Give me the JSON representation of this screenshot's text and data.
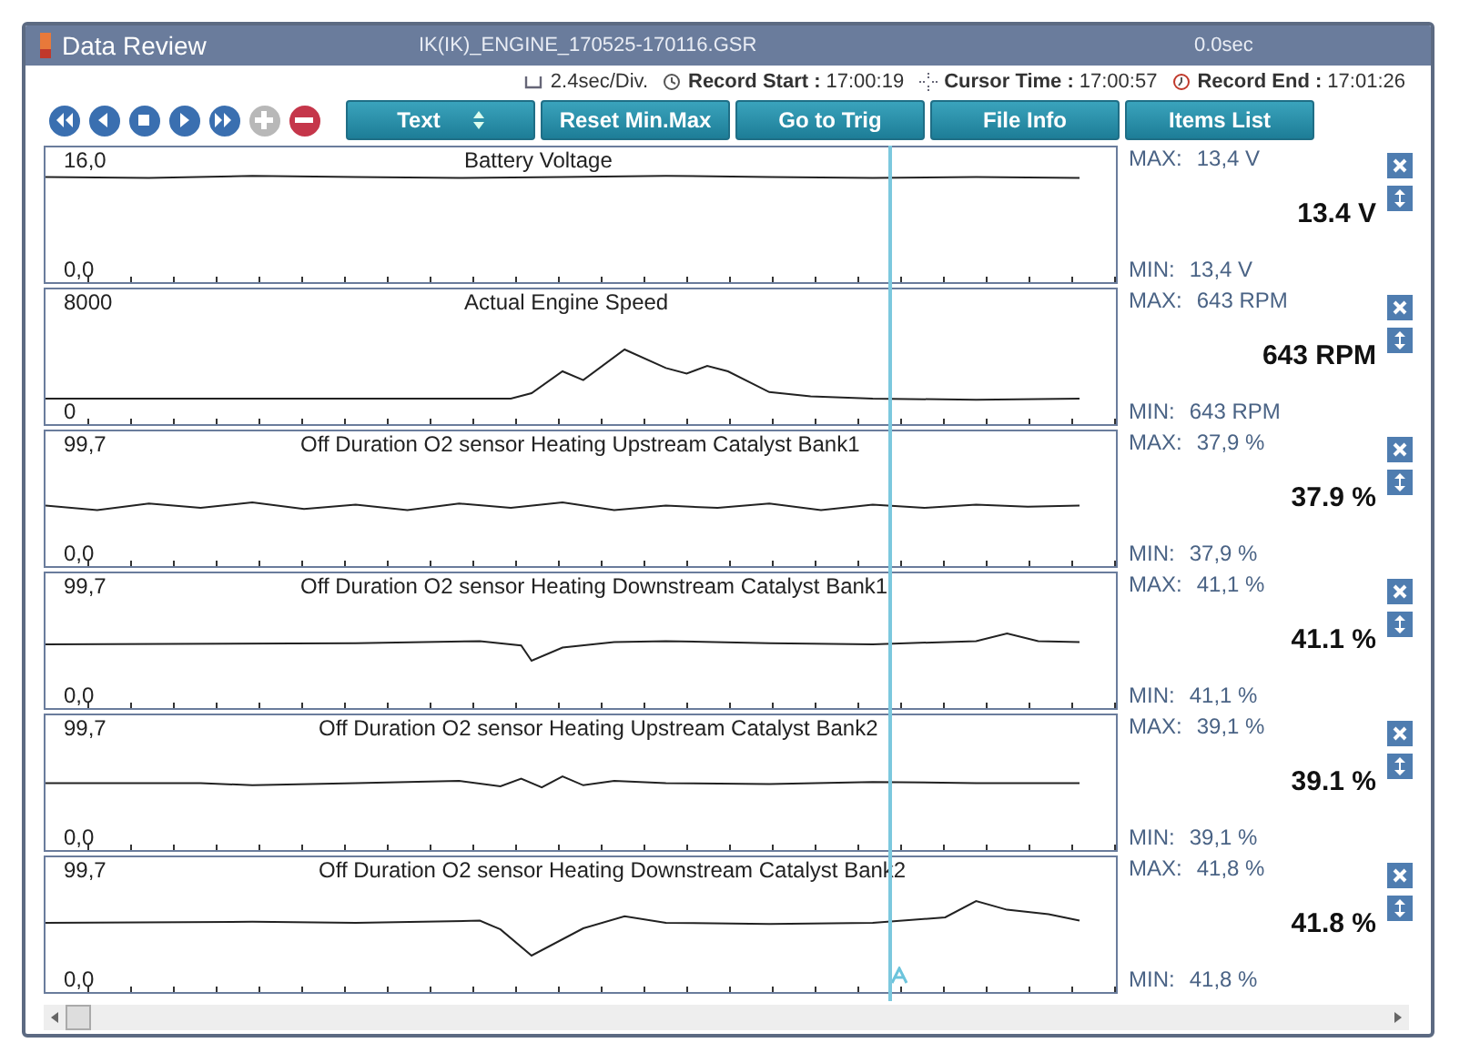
{
  "window": {
    "title": "Data Review",
    "file": "IK(IK)_ENGINE_170525-170116.GSR",
    "elapsed": "0.0sec"
  },
  "info": [
    {
      "kind": "division",
      "label": "2.4sec/Div."
    },
    {
      "kind": "start",
      "label": "Record Start :",
      "value": "17:00:19"
    },
    {
      "kind": "cursor",
      "label": "Cursor Time :",
      "value": "17:00:57"
    },
    {
      "kind": "end",
      "label": "Record End :",
      "value": "17:01:26"
    }
  ],
  "playback": [
    {
      "kind": "rewind",
      "disabled": false
    },
    {
      "kind": "back",
      "disabled": false
    },
    {
      "kind": "stop",
      "disabled": false
    },
    {
      "kind": "play",
      "disabled": false
    },
    {
      "kind": "forward",
      "disabled": false
    },
    {
      "kind": "add",
      "disabled": true
    },
    {
      "kind": "remove",
      "disabled": false
    }
  ],
  "buttons": [
    {
      "label": "Text",
      "kind": "dropdown"
    },
    {
      "label": "Reset Min.Max",
      "kind": "button"
    },
    {
      "label": "Go to Trig",
      "kind": "button"
    },
    {
      "label": "File Info",
      "kind": "button"
    },
    {
      "label": "Items List",
      "kind": "button"
    }
  ],
  "panels": [
    {
      "title": "Battery Voltage",
      "axis_max": "16,0",
      "axis_min": "0,0",
      "max_caption": "MAX:",
      "max": "13,4 V",
      "value": "13.4 V",
      "min_caption": "MIN:",
      "min": "13,4 V"
    },
    {
      "title": "Actual Engine Speed",
      "axis_max": "8000",
      "axis_min": "0",
      "max_caption": "MAX:",
      "max": "643 RPM",
      "value": "643 RPM",
      "min_caption": "MIN:",
      "min": "643 RPM"
    },
    {
      "title": "Off Duration O2 sensor Heating Upstream Catalyst Bank1",
      "axis_max": "99,7",
      "axis_min": "0,0",
      "max_caption": "MAX:",
      "max": "37,9 %",
      "value": "37.9 %",
      "min_caption": "MIN:",
      "min": "37,9 %"
    },
    {
      "title": "Off Duration O2 sensor Heating Downstream Catalyst Bank1",
      "axis_max": "99,7",
      "axis_min": "0,0",
      "max_caption": "MAX:",
      "max": "41,1 %",
      "value": "41.1 %",
      "min_caption": "MIN:",
      "min": "41,1 %"
    },
    {
      "title": "Off Duration O2 sensor Heating Upstream Catalyst Bank2",
      "axis_max": "99,7",
      "axis_min": "0,0",
      "max_caption": "MAX:",
      "max": "39,1 %",
      "value": "39.1 %",
      "min_caption": "MIN:",
      "min": "39,1 %"
    },
    {
      "title": "Off Duration O2 sensor Heating Downstream Catalyst Bank2",
      "axis_max": "99,7",
      "axis_min": "0,0",
      "max_caption": "MAX:",
      "max": "41,8 %",
      "value": "41.8 %",
      "min_caption": "MIN:",
      "min": "41,8 %"
    }
  ]
}
